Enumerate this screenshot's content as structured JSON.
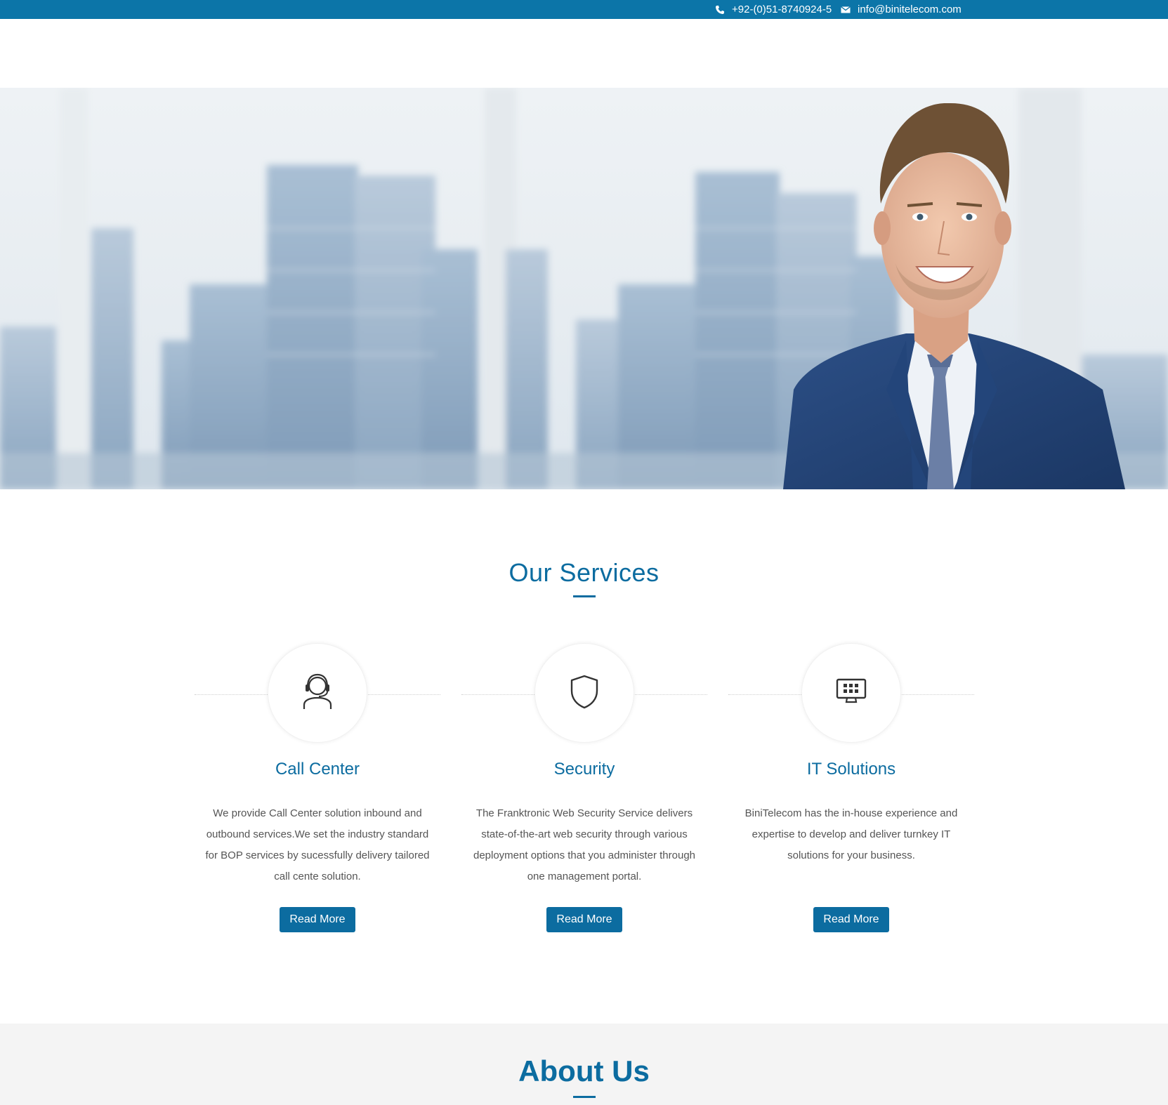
{
  "topbar": {
    "phone": "+92-(0)51-8740924-5",
    "email": "info@binitelecom.com",
    "phone_icon": "phone-icon",
    "email_icon": "envelope-icon",
    "background_color": "#0c75a8"
  },
  "services": {
    "title": "Our Services",
    "items": [
      {
        "icon": "headset-agent-icon",
        "name": "Call Center",
        "lines": [
          "We provide Call Center solution inbound and",
          "outbound services.We set the industry standard",
          "for BOP services by sucessfully delivery tailored",
          "call cente solution."
        ],
        "button": "Read More"
      },
      {
        "icon": "shield-icon",
        "name": "Security",
        "lines": [
          "The Franktronic Web Security Service delivers",
          "state-of-the-art web security through various",
          "deployment options that you administer through",
          "one management portal."
        ],
        "button": "Read More"
      },
      {
        "icon": "monitor-icon",
        "name": "IT Solutions",
        "lines": [
          "BiniTelecom has the in-house experience and",
          "expertise to develop and deliver turnkey IT",
          "solutions for your business."
        ],
        "button": "Read More"
      }
    ]
  },
  "about": {
    "title": "About Us"
  },
  "colors": {
    "accent": "#0c6ca0",
    "about_background": "#f4f4f4"
  }
}
